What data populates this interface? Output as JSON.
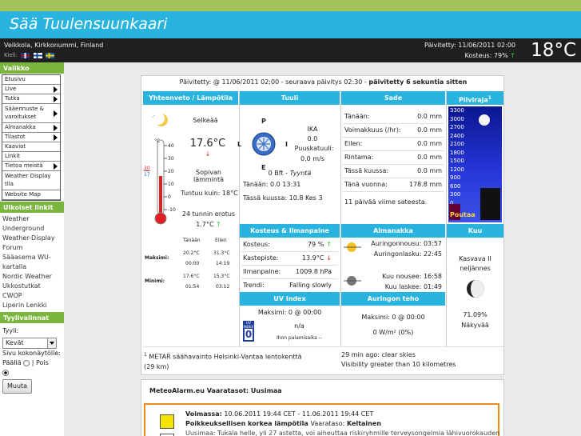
{
  "site_title": "Sää Tuulensuunkaari",
  "header": {
    "location": "Veikkola, Kirkkonummi, Finland",
    "language_label": "Kieli:",
    "updated": "Päivitetty:  11/06/2011 02:00",
    "humidity": "Kosteus: 79%",
    "humidity_arrow": "↑",
    "big_temp": "18°C"
  },
  "sidebar": {
    "menu_title": "Valikko",
    "menu": [
      {
        "label": "Etusivu",
        "arrow": false
      },
      {
        "label": "Live",
        "arrow": true
      },
      {
        "label": "Tutka",
        "arrow": true
      },
      {
        "label": "Sääennuste & varoitukset",
        "arrow": true
      },
      {
        "label": "Almanakka",
        "arrow": true
      },
      {
        "label": "Tilastot",
        "arrow": true
      },
      {
        "label": "Kaaviot",
        "arrow": false
      },
      {
        "label": "Linkit",
        "arrow": false
      },
      {
        "label": "Tietoa meistä",
        "arrow": true
      },
      {
        "label": "Weather Display tila",
        "arrow": false
      },
      {
        "label": "Website Map",
        "arrow": false
      }
    ],
    "links_title": "Ulkoiset linkit",
    "links": [
      "Weather Underground",
      "Weather-Display Forum",
      "Sääasema WU-kartalla",
      "Nordic Weather",
      "Ukkostutkat",
      "CWOP",
      "Liperin Lenkki"
    ],
    "style_title": "Tyylivalinnat",
    "style_label": "Tyyli:",
    "style_value": "Kevät",
    "width_label": "Sivu kokonäytölle:",
    "width_on": "Päällä",
    "width_off": "| Pois",
    "change_button": "Muuta"
  },
  "panel": {
    "update_line_prefix": "Päivitetty: @ 11/06/2011 02:00 - seuraava päivitys 02:30  -",
    "update_line_bold": "päivitetty 6 sekuntia sitten",
    "col_headers": [
      "Yhteenveto / Lämpötila",
      "Tuuli",
      "Sade",
      "Pilviraja"
    ],
    "pilviraja_sup": "1",
    "summary": {
      "condition": "Selkeää",
      "temp": "17.6°C",
      "temp_arrow": "↓",
      "feel": "Sopivan lämmintä",
      "dew_feel": "Tuntuu kuin: 18°C",
      "diff_label": "24 tunnin erotus",
      "diff_value": "1.7°C",
      "diff_arrow": "↑",
      "thermo_marks": [
        "40",
        "30",
        "20",
        "10",
        "0",
        "-10"
      ],
      "thermo_left_f": "°F",
      "thermo_left_c": "°C",
      "thermo_f_marks": [
        "20",
        "17"
      ],
      "minmax_headers": [
        "Tänään",
        "Eilen"
      ],
      "max_label": "Maksimi:",
      "min_label": "Minimi:",
      "max_today": "20.2°C",
      "max_today_time": "00:00",
      "max_yday": "31.3°C",
      "max_yday_time": "14:19",
      "min_today": "17.6°C",
      "min_today_time": "01:54",
      "min_yday": "15.3°C",
      "min_yday_time": "03:12"
    },
    "wind": {
      "compass": [
        "P",
        "I",
        "E",
        "L"
      ],
      "dir": "IKA",
      "speed": "0.0",
      "gust_label": "Puuskatuuli:",
      "gust": "0.0 m/s",
      "bft": "0 Bft -",
      "bft_desc": "Tyyntä",
      "today": "Tänään: 0.0 13:31",
      "month": "Tässä kuussa: 10.8 Kes 3"
    },
    "rain": {
      "rows": [
        {
          "label": "Tänään:",
          "value": "0.0 mm"
        },
        {
          "label": "Voimakkuus (/hr):",
          "value": "0.0 mm"
        },
        {
          "label": "Eilen:",
          "value": "0.0 mm"
        },
        {
          "label": "Rintama:",
          "value": "0.0 mm"
        },
        {
          "label": "Tässä kuussa:",
          "value": "0.0 mm"
        },
        {
          "label": "Tänä vuonna:",
          "value": "178.8 mm"
        }
      ],
      "days_since": "11 päivää viime sateesta."
    },
    "cloud": {
      "levels": [
        "3300",
        "3000",
        "2700",
        "2400",
        "2100",
        "1800",
        "1500",
        "1200",
        "900",
        "600",
        "300",
        "0"
      ],
      "current": "Poutaa"
    },
    "humidity_headers": [
      "Kosteus & Ilmanpaine",
      "Almanakka",
      "Kuu"
    ],
    "humidity": {
      "rows": [
        {
          "label": "Kosteus:",
          "value": "79 %",
          "arrow": "↑"
        },
        {
          "label": "Kastepiste:",
          "value": "13.9°C",
          "arrow": "↓"
        },
        {
          "label": "Ilmanpaine:",
          "value": "1009.8 hPa",
          "arrow": ""
        },
        {
          "label": "Trendi:",
          "value": "Falling slowly",
          "arrow": ""
        }
      ]
    },
    "almanac": {
      "sunrise": "Auringonnousu: 03:57",
      "sunset": "Auringonlasku: 22:45",
      "moonrise": "Kuu nousee: 16:58",
      "moonset": "Kuu laskee: 01:49"
    },
    "moon": {
      "phase": "Kasvava II neljännes",
      "percent": "71.09%",
      "visible": "Näkyvää"
    },
    "uv_header": "UV Index",
    "uv": {
      "max": "Maksimi: 0 @ 00:00",
      "na": "n/a",
      "burn": "Ihon palamisaika --",
      "badge_top": "UV INDEX",
      "badge_value": "0"
    },
    "solar_header": "Auringon teho",
    "solar": {
      "max": "Maksimi: 0 @ 00:00",
      "value": "0 W/m² (0%)"
    },
    "metar_sup": "1",
    "metar": "METAR säähavainto Helsinki-Vantaa lentokenttä (29 km)",
    "metar_right_1": "29 min ago: clear skies",
    "metar_right_2": "Visibility greater than 10 kilometres"
  },
  "alarm": {
    "title": "MeteoAlarm.eu Vaaratasot: Uusimaa",
    "valid_label": "Voimassa:",
    "valid": "10.06.2011 19:44 CET - 11.06.2011 19:44 CET",
    "warning_label": "Poikkeuksellisen korkea lämpötila",
    "level_label": "Vaarataso:",
    "level": "Keltainen",
    "desc": "Uusimaa: Tukala helle, yli 27 astetta, voi aiheuttaa riskiryhmille terveysongelmia lähivuorokauden"
  },
  "colors": {
    "accent": "#29b4df",
    "sidebar_green": "#7ab63e",
    "top_green": "#a3c257",
    "alarm_orange": "#f08a1c",
    "alarm_yellow": "#f5e400"
  }
}
